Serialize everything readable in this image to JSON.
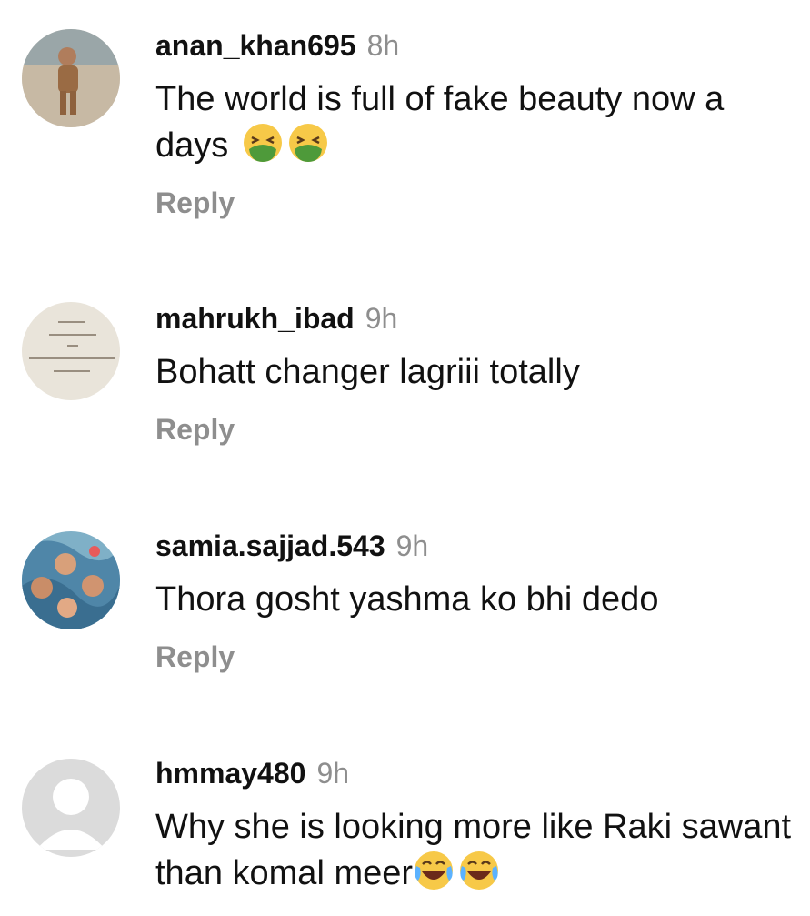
{
  "comments": [
    {
      "username": "anan_khan695",
      "time": "8h",
      "text": "The world is full of fake beauty now a days",
      "emojis": [
        "nauseated-face",
        "nauseated-face"
      ],
      "reply": "Reply"
    },
    {
      "username": "mahrukh_ibad",
      "time": "9h",
      "text": "Bohatt changer lagriii totally",
      "emojis": [],
      "reply": "Reply"
    },
    {
      "username": "samia.sajjad.543",
      "time": "9h",
      "text": "Thora gosht yashma ko bhi dedo",
      "emojis": [],
      "reply": "Reply"
    },
    {
      "username": "hmmay480",
      "time": "9h",
      "text": "Why she is looking more like Raki sawant than komal meer",
      "emojis": [
        "tears-of-joy",
        "tears-of-joy"
      ],
      "reply": ""
    }
  ],
  "colors": {
    "username": "#111111",
    "time": "#8e8e8e",
    "reply": "#8e8e8e"
  }
}
